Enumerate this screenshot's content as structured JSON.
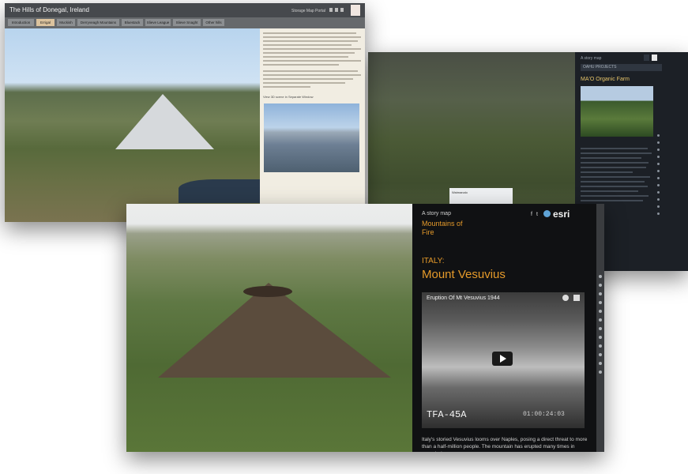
{
  "card_donegal": {
    "title": "The Hills of Donegal, Ireland",
    "header_link": "Storage Map Portal",
    "tabs": [
      "Introduction",
      "Errigal",
      "Muckish",
      "Derryveagh Mountains",
      "Bluestack",
      "Slieve League",
      "Slieve Snaght",
      "Other hills"
    ],
    "active_tab": 1,
    "side_caption": "View 3D scene in Separate Window"
  },
  "card_organic": {
    "story_map": "A story map",
    "section": "OAHU PROJECTS",
    "title": "MA'O Organic Farm",
    "popup_title": "Waimanalo"
  },
  "card_vesuvius": {
    "story_map_label": "A story map",
    "series_title": "Mountains of Fire",
    "country": "ITALY:",
    "title": "Mount Vesuvius",
    "video_title": "Eruption Of Mt Vesuvius 1944",
    "film_code": "TFA-45A",
    "timecode": "01:00:24:03",
    "brand": "esri",
    "description": "Italy's storied Vesuvius looms over Naples, posing a direct threat to more than a half-million people. The mountain has erupted many times in recorded"
  }
}
